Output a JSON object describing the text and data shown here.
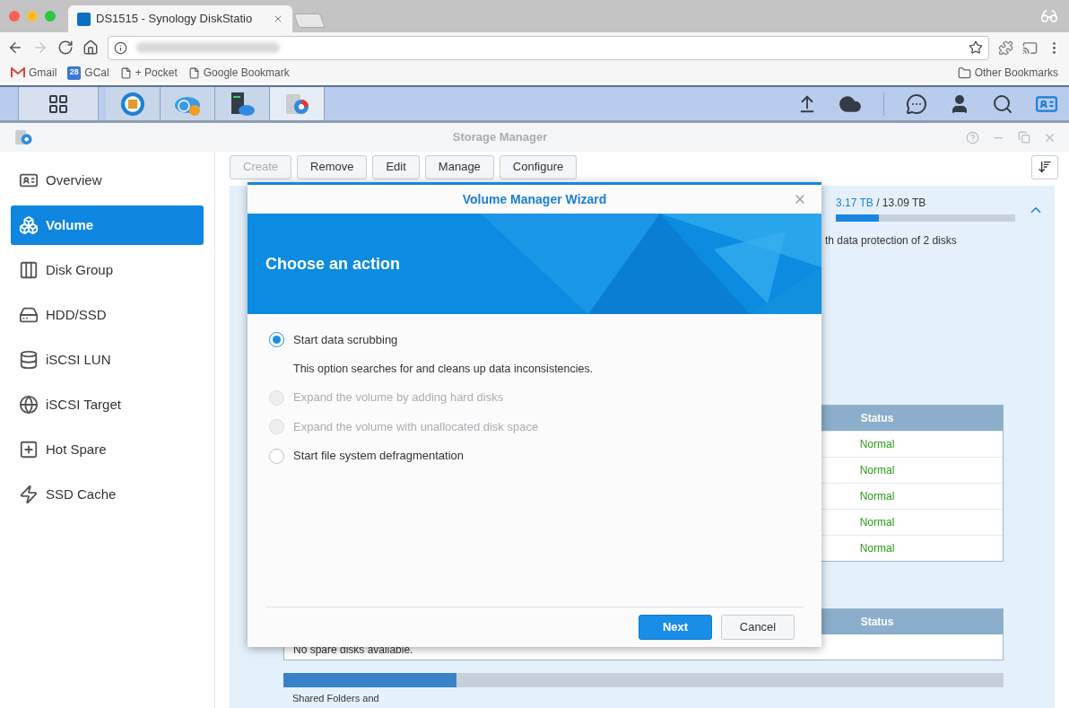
{
  "browser": {
    "tabs": [
      {
        "title": "DS1515 - Synology DiskStatio",
        "selected": true
      }
    ],
    "nav_buttons": [
      {
        "kind": "back",
        "disabled": false
      },
      {
        "kind": "forward",
        "disabled": true
      },
      {
        "kind": "reload",
        "disabled": false
      },
      {
        "kind": "home",
        "disabled": false
      }
    ],
    "bookmarks": [
      {
        "kind": "gmail",
        "label": "Gmail"
      },
      {
        "kind": "gcal",
        "label": "GCal",
        "badge": "28"
      },
      {
        "kind": "page",
        "label": "+ Pocket"
      },
      {
        "kind": "page",
        "label": "Google Bookmark"
      }
    ],
    "other_bookmarks": "Other Bookmarks"
  },
  "taskbar": {
    "apps": [
      {
        "kind": "package",
        "selected": false
      },
      {
        "kind": "cloud-globe",
        "selected": false
      },
      {
        "kind": "cloud-server",
        "selected": false
      },
      {
        "kind": "storage",
        "selected": true
      }
    ]
  },
  "window": {
    "title": "Storage Manager"
  },
  "sidebar": {
    "items": [
      {
        "kind": "overview",
        "label": "Overview",
        "selected": false
      },
      {
        "kind": "volume",
        "label": "Volume",
        "selected": true
      },
      {
        "kind": "disk-group",
        "label": "Disk Group",
        "selected": false
      },
      {
        "kind": "hdd",
        "label": "HDD/SSD",
        "selected": false
      },
      {
        "kind": "lun",
        "label": "iSCSI LUN",
        "selected": false
      },
      {
        "kind": "target",
        "label": "iSCSI Target",
        "selected": false
      },
      {
        "kind": "hot-spare",
        "label": "Hot Spare",
        "selected": false
      },
      {
        "kind": "cache",
        "label": "SSD Cache",
        "selected": false
      }
    ]
  },
  "toolbar": {
    "buttons": [
      {
        "label": "Create",
        "disabled": true
      },
      {
        "label": "Remove",
        "disabled": false
      },
      {
        "label": "Edit",
        "disabled": false
      },
      {
        "label": "Manage",
        "disabled": false
      },
      {
        "label": "Configure",
        "disabled": false
      }
    ]
  },
  "volume": {
    "used": "3.17 TB",
    "total": "/ 13.09 TB",
    "level": 0.24,
    "description": "th data protection of 2 disks"
  },
  "disk_table": {
    "columns": [
      "Status"
    ],
    "rows": [
      {
        "status": "Normal"
      },
      {
        "status": "Normal"
      },
      {
        "status": "Normal"
      },
      {
        "status": "Normal"
      },
      {
        "status": "Normal"
      }
    ]
  },
  "hot_spare_table": {
    "columns": [
      "Status"
    ],
    "empty_text": "No spare disks available."
  },
  "shared_folders": {
    "level": 0.24,
    "label": "Shared Folders and"
  },
  "dialog": {
    "title": "Volume Manager Wizard",
    "heading": "Choose an action",
    "options": [
      {
        "label": "Start data scrubbing",
        "selected": true,
        "disabled": false,
        "description": "This option searches for and cleans up data inconsistencies."
      },
      {
        "label": "Expand the volume by adding hard disks",
        "selected": false,
        "disabled": true
      },
      {
        "label": "Expand the volume with unallocated disk space",
        "selected": false,
        "disabled": true
      },
      {
        "label": "Start file system defragmentation",
        "selected": false,
        "disabled": false
      }
    ],
    "buttons": [
      {
        "kind": "primary",
        "label": "Next"
      },
      {
        "kind": "secondary",
        "label": "Cancel"
      }
    ]
  }
}
